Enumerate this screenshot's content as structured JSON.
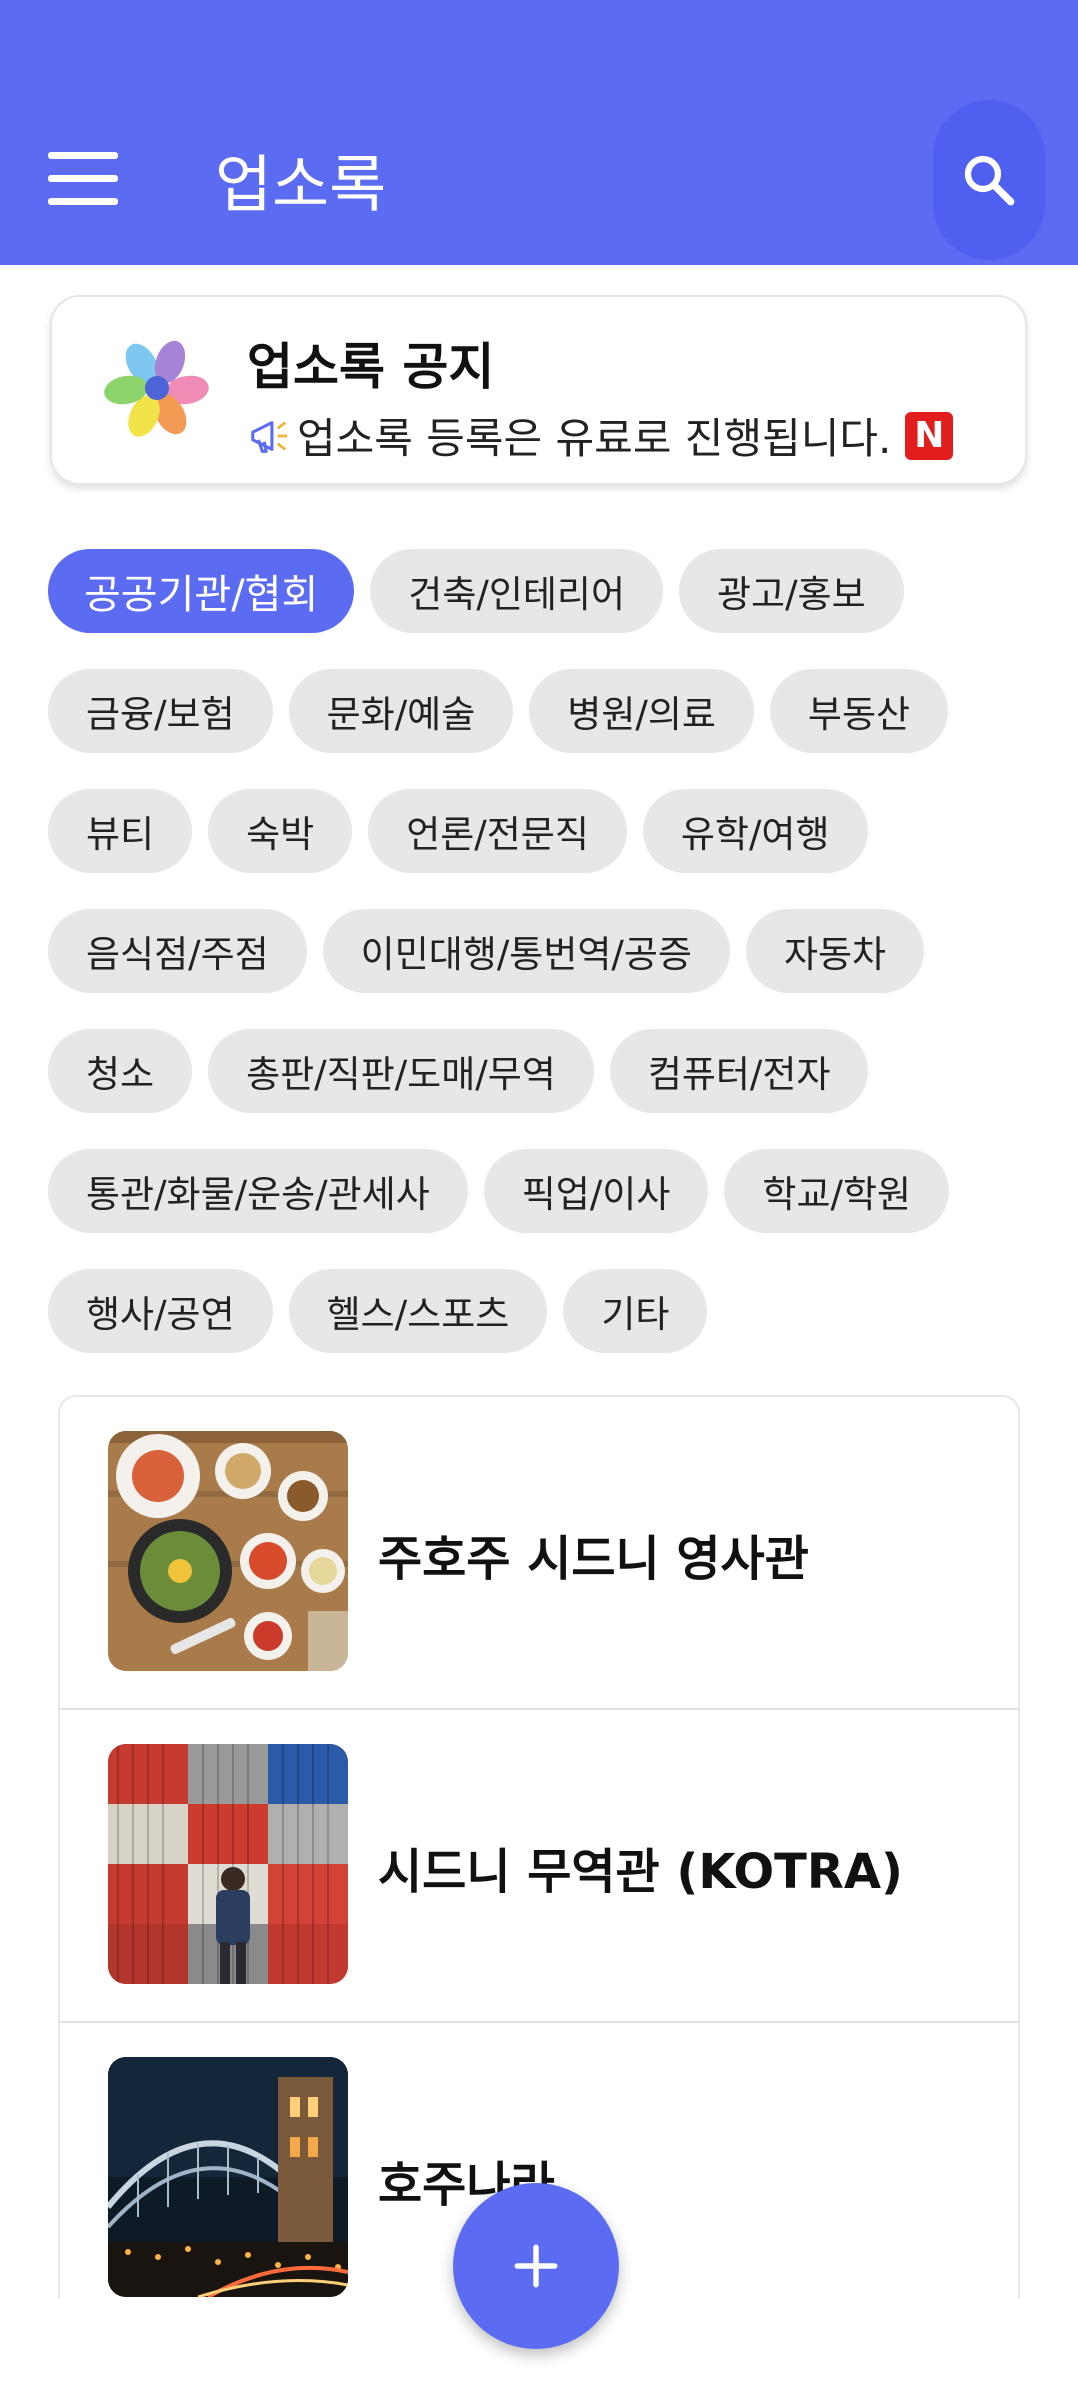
{
  "appbar": {
    "title": "업소록"
  },
  "notice": {
    "title": "업소록 공지",
    "text": "업소록 등록은 유료로 진행됩니다.",
    "badge": "N"
  },
  "categories": [
    [
      "공공기관/협회",
      "건축/인테리어",
      "광고/홍보"
    ],
    [
      "금융/보험",
      "문화/예술",
      "병원/의료",
      "부동산"
    ],
    [
      "뷰티",
      "숙박",
      "언론/전문직",
      "유학/여행"
    ],
    [
      "음식점/주점",
      "이민대행/통번역/공증",
      "자동차"
    ],
    [
      "청소",
      "총판/직판/도매/무역",
      "컴퓨터/전자"
    ],
    [
      "통관/화물/운송/관세사",
      "픽업/이사",
      "학교/학원"
    ],
    [
      "행사/공연",
      "헬스/스포츠",
      "기타"
    ]
  ],
  "selected_category": "공공기관/협회",
  "listings": [
    {
      "name": "주호주 시드니 영사관"
    },
    {
      "name": "시드니 무역관 (KOTRA)"
    },
    {
      "name": "호주나라"
    }
  ],
  "colors": {
    "primary": "#5c6cf2",
    "chip": "#e7e7e9",
    "badge": "#e21d1d"
  }
}
